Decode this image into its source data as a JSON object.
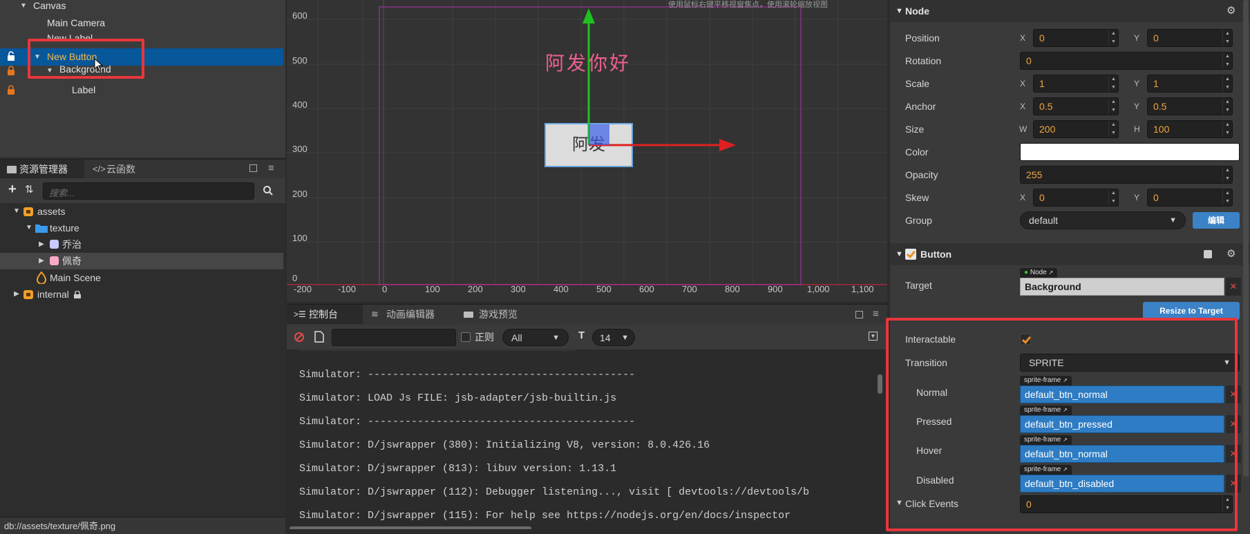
{
  "hierarchy": {
    "items": [
      {
        "label": "Canvas"
      },
      {
        "label": "Main Camera"
      },
      {
        "label": "New Label"
      },
      {
        "label": "New Button"
      },
      {
        "label": "Background"
      },
      {
        "label": "Label"
      }
    ]
  },
  "assets_panel": {
    "tab_assets": "资源管理器",
    "tab_cloud": "云函数",
    "search_placeholder": "搜索...",
    "items": [
      {
        "label": "assets"
      },
      {
        "label": "texture"
      },
      {
        "label": "乔治"
      },
      {
        "label": "佩奇"
      },
      {
        "label": "Main Scene"
      },
      {
        "label": "internal"
      }
    ],
    "status_path": "db://assets/texture/佩奇.png"
  },
  "scene": {
    "hint": "使用鼠标右键平移视窗焦点，使用滚轮缩放视图",
    "canvas_text": "阿发你好",
    "button_text": "阿发",
    "y_ticks": [
      "600",
      "500",
      "400",
      "300",
      "200",
      "100",
      "0"
    ],
    "x_ticks": [
      "-200",
      "-100",
      "0",
      "100",
      "200",
      "300",
      "400",
      "500",
      "600",
      "700",
      "800",
      "900",
      "1,000",
      "1,100"
    ]
  },
  "console": {
    "tab_console": "控制台",
    "tab_anim": "动画编辑器",
    "tab_preview": "游戏预览",
    "regex_label": "正则",
    "level_value": "All",
    "font_size_value": "14",
    "lines": [
      "Simulator: -------------------------------------------",
      "Simulator: LOAD Js FILE: jsb-adapter/jsb-builtin.js",
      "Simulator: -------------------------------------------",
      "Simulator: D/jswrapper (380): Initializing V8, version: 8.0.426.16",
      "Simulator: D/jswrapper (813): libuv version: 1.13.1",
      "Simulator: D/jswrapper (112): Debugger listening..., visit [ devtools://devtools/b",
      "Simulator: D/jswrapper (115): For help see https://nodejs.org/en/docs/inspector"
    ]
  },
  "inspector": {
    "node_title": "Node",
    "position_label": "Position",
    "position_x": "0",
    "position_y": "0",
    "rotation_label": "Rotation",
    "rotation": "0",
    "scale_label": "Scale",
    "scale_x": "1",
    "scale_y": "1",
    "anchor_label": "Anchor",
    "anchor_x": "0.5",
    "anchor_y": "0.5",
    "size_label": "Size",
    "size_w": "200",
    "size_h": "100",
    "color_label": "Color",
    "opacity_label": "Opacity",
    "opacity": "255",
    "skew_label": "Skew",
    "skew_x": "0",
    "skew_y": "0",
    "group_label": "Group",
    "group_value": "default",
    "edit_button": "编辑",
    "axis_x": "X",
    "axis_y": "Y",
    "axis_w": "W",
    "axis_h": "H",
    "button_title": "Button",
    "target_label": "Target",
    "target_tag": "Node",
    "target_value": "Background",
    "resize_button": "Resize to Target",
    "interactable_label": "Interactable",
    "transition_label": "Transition",
    "transition_value": "SPRITE",
    "sprite_tag": "sprite-frame",
    "normal_label": "Normal",
    "normal_value": "default_btn_normal",
    "pressed_label": "Pressed",
    "pressed_value": "default_btn_pressed",
    "hover_label": "Hover",
    "hover_value": "default_btn_normal",
    "disabled_label": "Disabled",
    "disabled_value": "default_btn_disabled",
    "click_events_label": "Click Events",
    "click_events_value": "0"
  },
  "colors": {
    "selection": "#07579b",
    "highlight_box": "#e8363c",
    "number_text": "#f0a640",
    "asset_field": "#2e7cc3",
    "scene_text": "#ee5f91"
  }
}
